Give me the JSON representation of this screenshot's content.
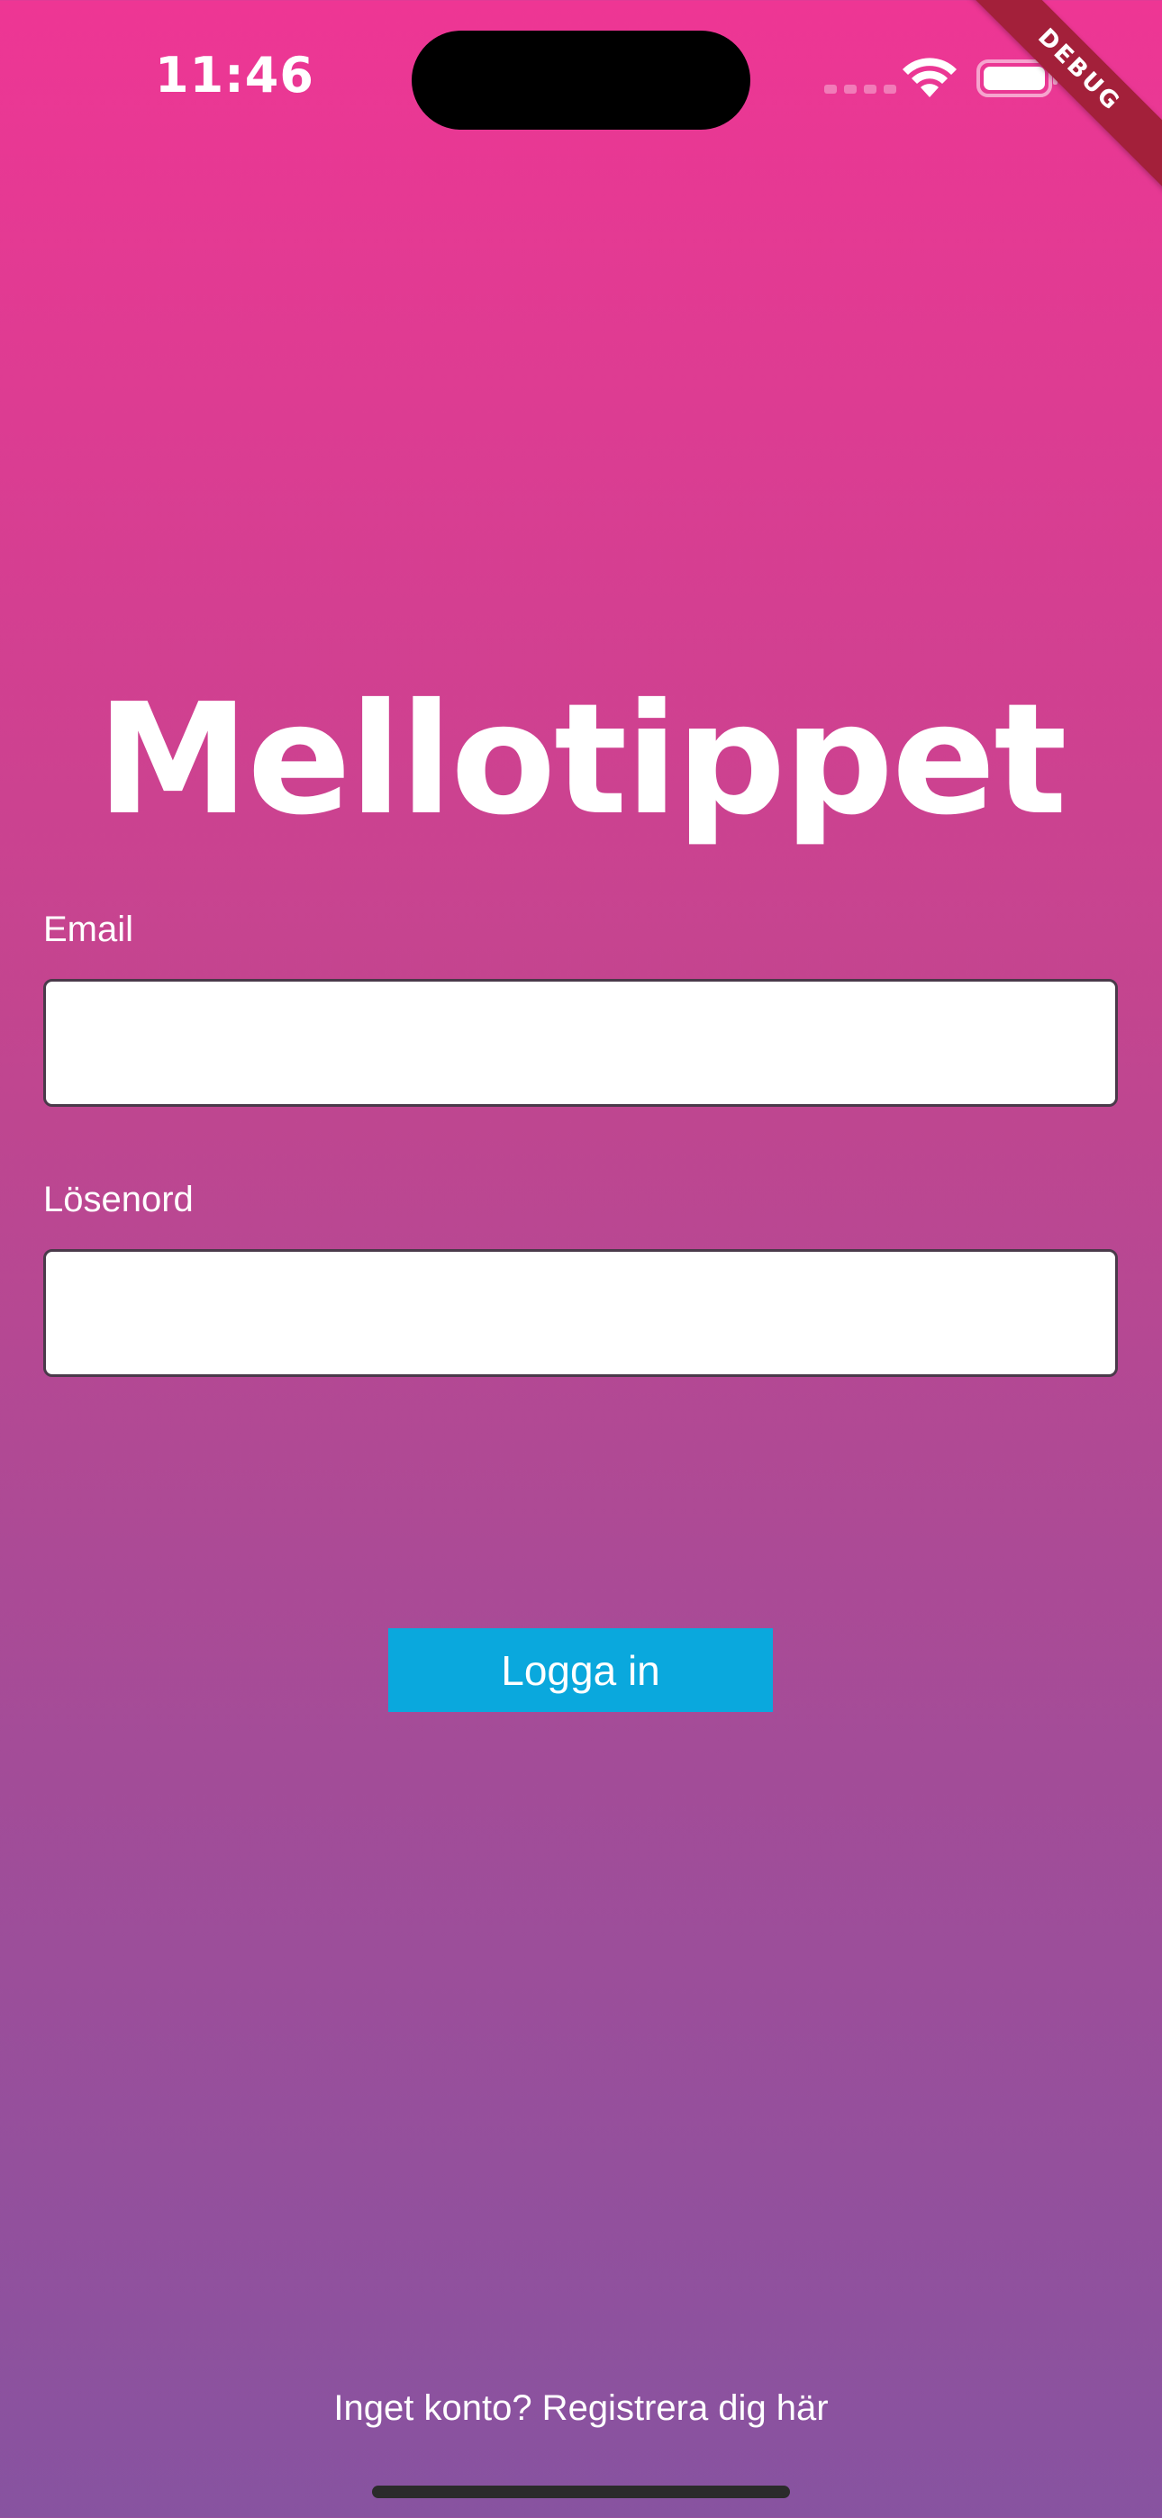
{
  "status_bar": {
    "time": "11:46"
  },
  "debug_banner": "DEBUG",
  "app": {
    "title": "Mellotippet"
  },
  "form": {
    "email_label": "Email",
    "email_value": "",
    "password_label": "Lösenord",
    "password_value": "",
    "login_button": "Logga in"
  },
  "footer": {
    "register_text": "Inget konto? Registrera dig här"
  },
  "colors": {
    "gradient_top": "#ee3694",
    "gradient_bottom": "#8753a0",
    "button": "#0aa8dd",
    "debug_ribbon": "#a3203a"
  }
}
